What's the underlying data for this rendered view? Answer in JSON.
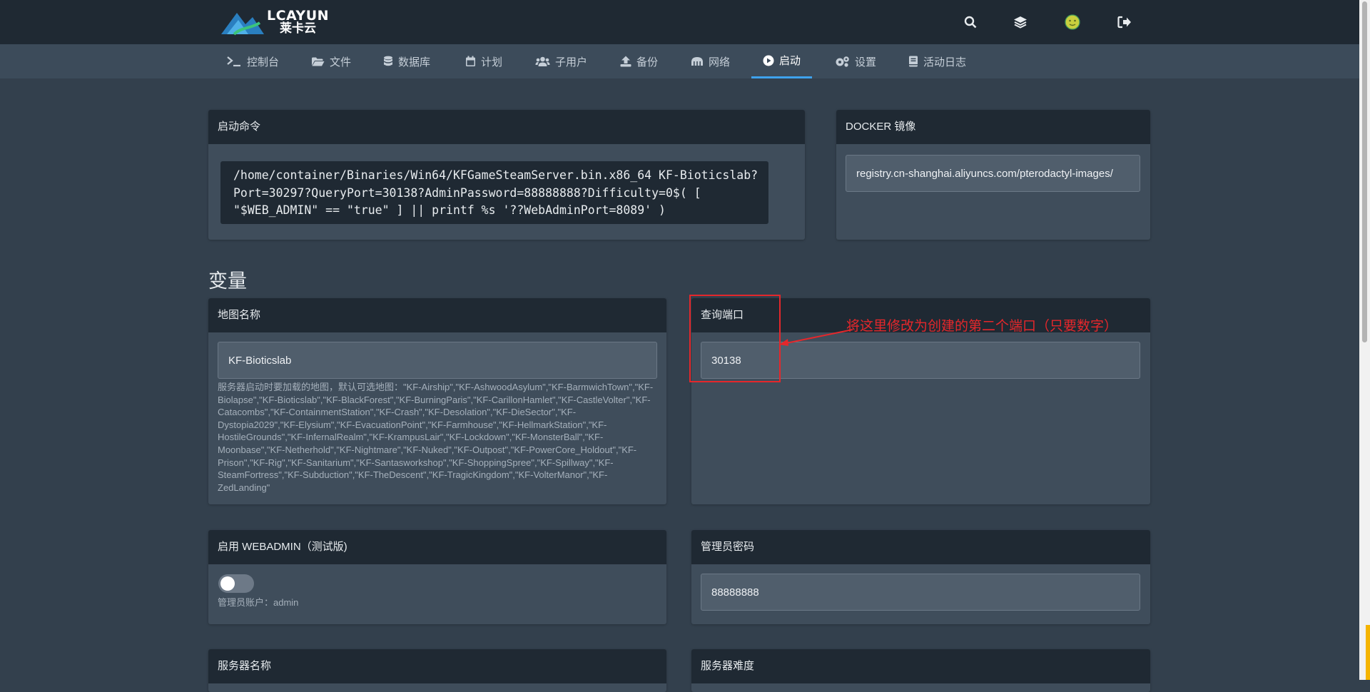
{
  "brand": {
    "logo_text": "LCAYUN",
    "logo_subtext": "莱卡云"
  },
  "topbar_icons": [
    "search-icon",
    "layers-icon",
    "avatar-icon",
    "logout-icon"
  ],
  "nav": {
    "items": [
      {
        "label": "控制台",
        "icon": "terminal-icon"
      },
      {
        "label": "文件",
        "icon": "folder-icon"
      },
      {
        "label": "数据库",
        "icon": "database-icon"
      },
      {
        "label": "计划",
        "icon": "calendar-icon"
      },
      {
        "label": "子用户",
        "icon": "users-icon"
      },
      {
        "label": "备份",
        "icon": "upload-icon"
      },
      {
        "label": "网络",
        "icon": "network-icon"
      },
      {
        "label": "启动",
        "icon": "play-icon",
        "active": true
      },
      {
        "label": "设置",
        "icon": "cogs-icon"
      },
      {
        "label": "活动日志",
        "icon": "book-icon"
      }
    ]
  },
  "startup": {
    "title": "启动命令",
    "command": "/home/container/Binaries/Win64/KFGameSteamServer.bin.x86_64 KF-Bioticslab?\nPort=30297?QueryPort=30138?AdminPassword=88888888?Difficulty=0$( [\n\"$WEB_ADMIN\" == \"true\" ] || printf %s '??WebAdminPort=8089' )"
  },
  "docker": {
    "title": "DOCKER 镜像",
    "value": "registry.cn-shanghai.aliyuncs.com/pterodactyl-images/"
  },
  "variables_title": "变量",
  "variables": {
    "map_name": {
      "title": "地图名称",
      "value": "KF-Bioticslab",
      "help": "服务器启动时要加载的地图，默认可选地图：\"KF-Airship\",\"KF-AshwoodAsylum\",\"KF-BarmwichTown\",\"KF-Biolapse\",\"KF-Bioticslab\",\"KF-BlackForest\",\"KF-BurningParis\",\"KF-CarillonHamlet\",\"KF-CastleVolter\",\"KF-Catacombs\",\"KF-ContainmentStation\",\"KF-Crash\",\"KF-Desolation\",\"KF-DieSector\",\"KF-Dystopia2029\",\"KF-Elysium\",\"KF-EvacuationPoint\",\"KF-Farmhouse\",\"KF-HellmarkStation\",\"KF-HostileGrounds\",\"KF-InfernalRealm\",\"KF-KrampusLair\",\"KF-Lockdown\",\"KF-MonsterBall\",\"KF-Moonbase\",\"KF-Netherhold\",\"KF-Nightmare\",\"KF-Nuked\",\"KF-Outpost\",\"KF-PowerCore_Holdout\",\"KF-Prison\",\"KF-Rig\",\"KF-Sanitarium\",\"KF-Santasworkshop\",\"KF-ShoppingSpree\",\"KF-Spillway\",\"KF-SteamFortress\",\"KF-Subduction\",\"KF-TheDescent\",\"KF-TragicKingdom\",\"KF-VolterManor\",\"KF-ZedLanding\""
    },
    "query_port": {
      "title": "查询端口",
      "value": "30138"
    },
    "webadmin": {
      "title": "启用 WEBADMIN（测试版)",
      "enabled": false,
      "help": "管理员账户：admin"
    },
    "admin_password": {
      "title": "管理员密码",
      "value": "88888888"
    },
    "server_name": {
      "title": "服务器名称"
    },
    "server_difficulty": {
      "title": "服务器难度"
    }
  },
  "annotation": {
    "text": "将这里修改为创建的第二个端口（只要数字）",
    "color": "#e5272b"
  },
  "colors": {
    "accent": "#3ea2ec",
    "panel": "#3f4d5b",
    "header": "#1f2933",
    "background": "#33404d"
  }
}
